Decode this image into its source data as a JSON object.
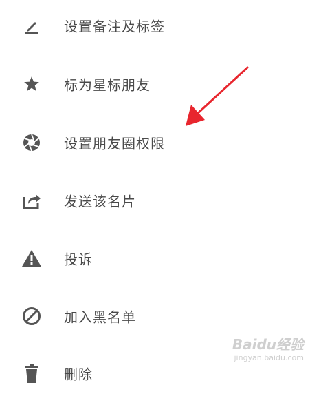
{
  "menu": {
    "items": [
      {
        "label": "设置备注及标签",
        "icon": "edit-pencil-icon"
      },
      {
        "label": "标为星标朋友",
        "icon": "star-icon"
      },
      {
        "label": "设置朋友圈权限",
        "icon": "shutter-icon"
      },
      {
        "label": "发送该名片",
        "icon": "share-icon"
      },
      {
        "label": "投诉",
        "icon": "warning-icon"
      },
      {
        "label": "加入黑名单",
        "icon": "block-icon"
      },
      {
        "label": "删除",
        "icon": "trash-icon"
      }
    ]
  },
  "watermark": {
    "main": "Baidu经验",
    "sub": "jingyan.baidu.com"
  },
  "colors": {
    "icon": "#555555",
    "text": "#4a4a4a",
    "arrow": "#e8262e"
  }
}
